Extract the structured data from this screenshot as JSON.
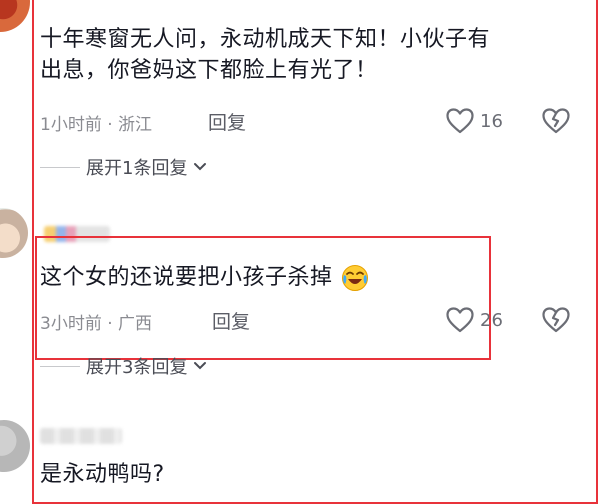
{
  "comments": [
    {
      "text_line1": "十年寒窗无人问，永动机成天下知！小伙子有",
      "text_line2": "出息，你爸妈这下都脸上有光了！",
      "time": "1小时前",
      "location": "浙江",
      "reply_label": "回复",
      "likes": "16",
      "expand_label": "展开1条回复"
    },
    {
      "text": "这个女的还说要把小孩子杀掉",
      "emoji": "😂",
      "time": "3小时前",
      "location": "广西",
      "reply_label": "回复",
      "likes": "26",
      "expand_label": "展开3条回复"
    },
    {
      "text": "是永动鸭吗?"
    }
  ],
  "separator": "·",
  "icons": {
    "like": "heart-outline-icon",
    "dislike": "broken-heart-outline-icon",
    "expand": "chevron-down-icon"
  },
  "colors": {
    "highlight_border": "#e8323a",
    "text": "#161823",
    "meta": "#8a8b91"
  }
}
